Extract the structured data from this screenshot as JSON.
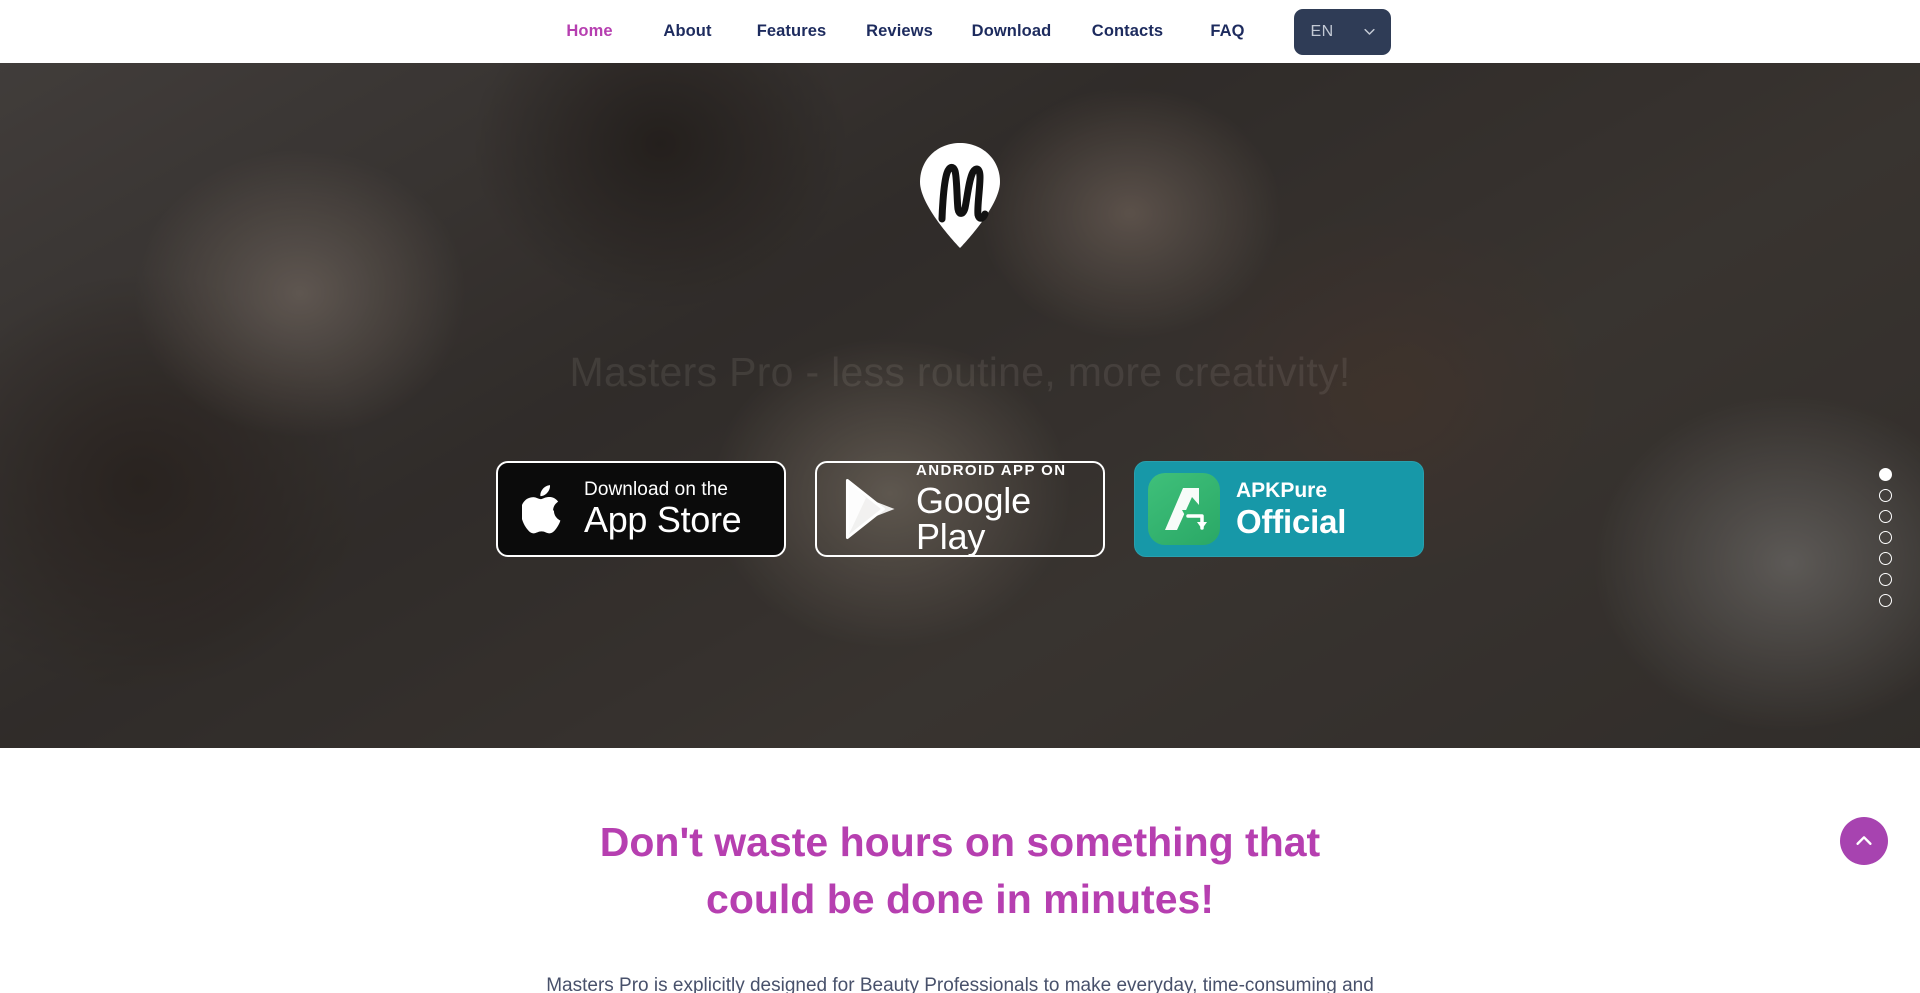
{
  "nav": {
    "items": [
      {
        "label": "Home",
        "active": true
      },
      {
        "label": "About",
        "active": false
      },
      {
        "label": "Features",
        "active": false
      },
      {
        "label": "Reviews",
        "active": false
      },
      {
        "label": "Download",
        "active": false
      },
      {
        "label": "Contacts",
        "active": false
      },
      {
        "label": "FAQ",
        "active": false
      }
    ],
    "language": {
      "value": "EN",
      "icon": "chevron-down-icon"
    },
    "active_color": "#b63fb0",
    "link_color": "#1d2b5e"
  },
  "hero": {
    "logo_icon": "masters-pro-pin-logo",
    "title": "Masters Pro - less routine, more creativity!",
    "badges": [
      {
        "id": "app-store",
        "icon": "apple-logo-icon",
        "small": "Download on the",
        "big": "App Store"
      },
      {
        "id": "google-play",
        "icon": "google-play-triangle-icon",
        "small": "ANDROID APP ON",
        "big": "Google Play"
      },
      {
        "id": "apkpure",
        "icon": "apkpure-a-icon",
        "small": "APKPure",
        "big": "Official",
        "bg_color": "#1798a8",
        "icon_color": "#34b96f"
      }
    ],
    "slider": {
      "total": 7,
      "active_index": 0
    }
  },
  "section": {
    "title_line1": "Don't waste hours on something that",
    "title_line2": "could be done in minutes!",
    "title_color": "#b63fb0",
    "body": "Masters Pro is explicitly designed for Beauty Professionals to make everyday, time-consuming and"
  },
  "scroll_top": {
    "icon": "chevron-up-icon",
    "color": "#a743b0"
  }
}
